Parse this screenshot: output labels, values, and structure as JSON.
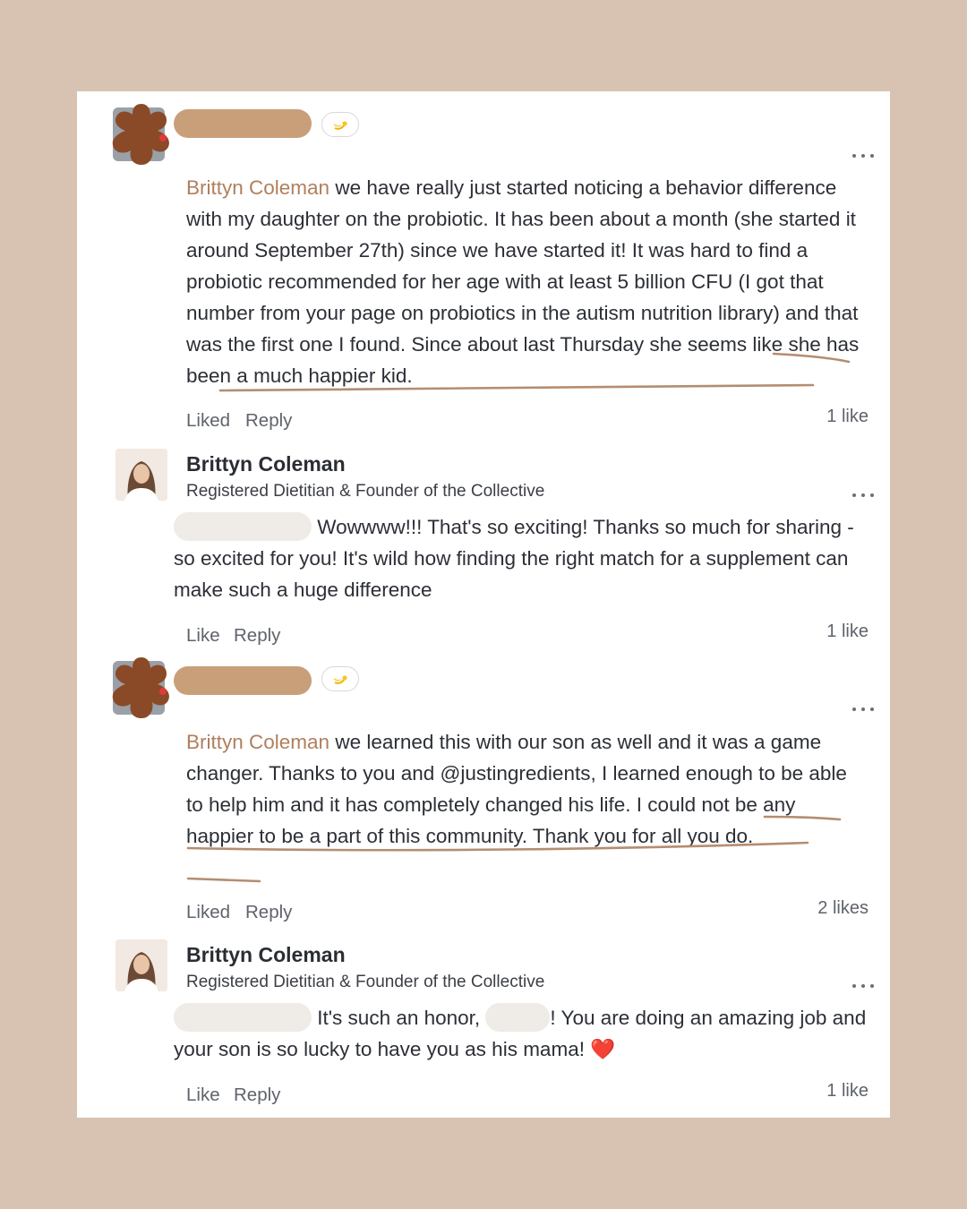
{
  "comments": [
    {
      "badge_icon": "comet-emoji-icon",
      "mention": "Brittyn Coleman",
      "text_a": " we have really just started noticing a behavior difference with my daughter on the probiotic. It has been about a month (she started it around September 27th) since we have started it! It was hard to find a probiotic recommended for her age with at least 5 billion CFU (I got that number from your page on probiotics in the autism nutrition library) and that was the first one I found. ",
      "text_b": "Since about last Thursday she seems like she has been a much happier",
      "text_c": " kid.",
      "like_label": "Liked",
      "reply_label": "Reply",
      "likes": "1 like"
    },
    {
      "author": "Brittyn Coleman",
      "subtitle": "Registered Dietitian & Founder of the Collective",
      "text": " Wowwww!!! That's so exciting! Thanks so much for sharing - so excited for you! It's wild how finding the right match for a supplement can make such a huge difference",
      "like_label": "Like",
      "reply_label": "Reply",
      "likes": "1 like"
    },
    {
      "badge_icon": "comet-emoji-icon",
      "mention": "Brittyn Coleman",
      "text_a": " we learned this with our son as well and it was a game changer. Thanks to you and @justingredients, I learned enough to be able to help him and it has completely changed his life. ",
      "text_b": "I could not be any happier to be a part of this community. Thank you for all you do.",
      "like_label": "Liked",
      "reply_label": "Reply",
      "likes": "2 likes"
    },
    {
      "author": "Brittyn Coleman",
      "subtitle": "Registered Dietitian & Founder of the Collective",
      "text_a": " It's such an honor, ",
      "text_b": "! You are doing an amazing job and your son is so lucky to have you as his mama! ",
      "heart": "❤️",
      "like_label": "Like",
      "reply_label": "Reply",
      "likes": "1 like"
    }
  ],
  "colors": {
    "background": "#d8c3b3",
    "mention": "#b07f5d",
    "redaction": "#c99f7a",
    "underline": "#b58d70"
  }
}
